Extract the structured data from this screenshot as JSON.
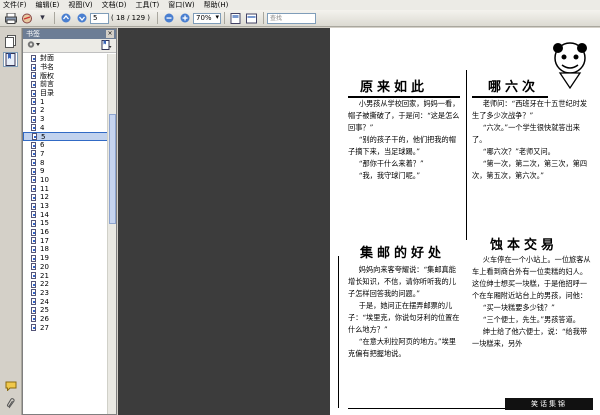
{
  "menu": [
    "文件(F)",
    "编辑(E)",
    "视图(V)",
    "文档(D)",
    "工具(T)",
    "窗口(W)",
    "帮助(H)"
  ],
  "toolbar": {
    "page_value": "5",
    "page_count": "( 18 / 129 )",
    "zoom": "70%",
    "search_placeholder": "查找"
  },
  "bookmarks": {
    "title": "书签",
    "items": [
      "封面",
      "书名",
      "版权",
      "前言",
      "目录",
      "1",
      "2",
      "3",
      "4",
      "5",
      "6",
      "7",
      "8",
      "9",
      "10",
      "11",
      "12",
      "13",
      "14",
      "15",
      "16",
      "17",
      "18",
      "19",
      "20",
      "21",
      "22",
      "23",
      "24",
      "25",
      "26",
      "27"
    ],
    "selected": "5"
  },
  "doc": {
    "art1_title": "原来如此",
    "art1_body": [
      "小男孩从学校回家，妈妈一看，帽子被撕破了，于是问：“这是怎么回事？”",
      "“别的孩子干的，他们把我的帽子摘下来，当足球踢。”",
      "“那你干什么来着？”",
      "“我，我守球门呢。”"
    ],
    "art2_title": "哪六次",
    "art2_body": [
      "老师问：“西班牙在十五世纪时发生了多少次战争？”",
      "“六次。”一个学生很快就答出来了。",
      "“哪六次？”老师又问。",
      "“第一次，第二次，第三次，第四次，第五次，第六次。”"
    ],
    "art3_title": "集邮的好处",
    "art3_body": [
      "妈妈向来客夸耀说：“集邮真能增长知识，不信，请你听听我的儿子怎样回答我的问题。”",
      "于是，她问正在摆弄邮票的儿子：“埃里克，你说句牙利的位置在什么地方？”",
      "“在意大利拉阿页的地方。”埃里克偏有把握地说。"
    ],
    "art4_title": "蚀本交易",
    "art4_body": [
      "火车停在一个小站上。一位旅客从车上看到商台外有一位卖糕的妇人。这位绅士想买一块糕，于是他招呼一个在车厢附近站台上的男孩，问他：",
      "“买一块糕要多少钱？”",
      "“三个便士，先生。”男孩答道。",
      "绅士给了他六便士，说：“给我带一块糕来，另外"
    ],
    "footer_tag": "笑话集锦"
  }
}
